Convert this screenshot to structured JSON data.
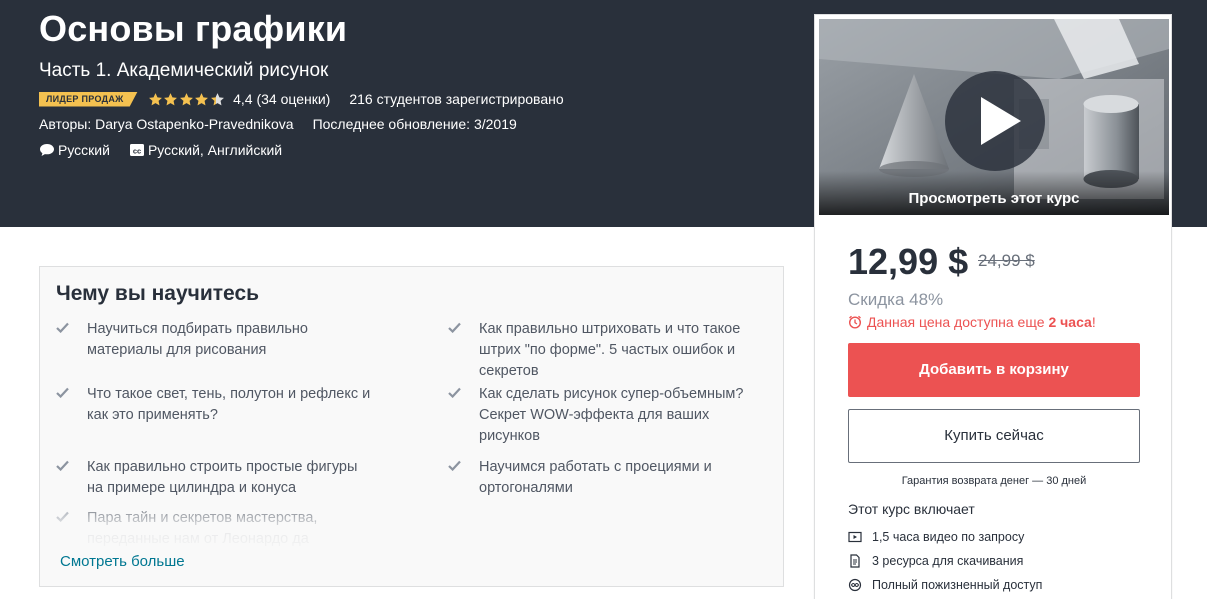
{
  "course": {
    "title": "Основы графики",
    "subtitle": "Часть 1. Академический рисунок",
    "badge": "ЛИДЕР ПРОДАЖ",
    "rating": 4.4,
    "rating_text": "4,4 (34 оценки)",
    "students": "216 студентов зарегистрировано",
    "authors": "Авторы: Darya Ostapenko-Pravednikova",
    "updated": "Последнее обновление: 3/2019",
    "language": "Русский",
    "captions": "Русский, Английский"
  },
  "colors": {
    "header_bg": "#29303b",
    "badge": "#f4c150",
    "star": "#f4c150",
    "accent_red": "#ec5252",
    "link": "#007791"
  },
  "icons": {
    "language": "speech-bubble-icon",
    "captions": "cc-icon",
    "play": "play-icon",
    "check": "check-icon",
    "timer": "alarm-clock-icon"
  },
  "sidebar": {
    "preview_label": "Просмотреть этот курс",
    "price": "12,99 $",
    "old_price": "24,99 $",
    "discount": "Скидка 48%",
    "timer_prefix": "Данная цена доступна еще",
    "timer_bold": "2 часа",
    "timer_suffix": "!",
    "add_to_cart": "Добавить в корзину",
    "buy_now": "Купить сейчас",
    "guarantee": "Гарантия возврата денег — 30 дней",
    "includes_title": "Этот курс включает",
    "includes": [
      {
        "icon": "video-icon",
        "label": "1,5 часа видео по запросу"
      },
      {
        "icon": "file-icon",
        "label": "3 ресурса для скачивания"
      },
      {
        "icon": "infinity-icon",
        "label": "Полный пожизненный доступ"
      }
    ]
  },
  "learn": {
    "heading": "Чему вы научитесь",
    "left": [
      "Научиться подбирать правильно материалы для рисования",
      "Что такое свет, тень, полутон и рефлекс и как это применять?",
      "Как правильно строить простые фигуры на примере цилиндра и конуса",
      "Пара тайн и секретов мастерства, переданные нам от Леонардо да"
    ],
    "right": [
      "Как правильно штриховать и что такое штрих \"по форме\". 5 частых ошибок и секретов",
      "Как сделать рисунок супер-объемным? Секрет WOW-эффекта для ваших рисунков",
      "Научимся работать с проециями и ортогоналями"
    ],
    "see_more": "Смотреть больше"
  }
}
